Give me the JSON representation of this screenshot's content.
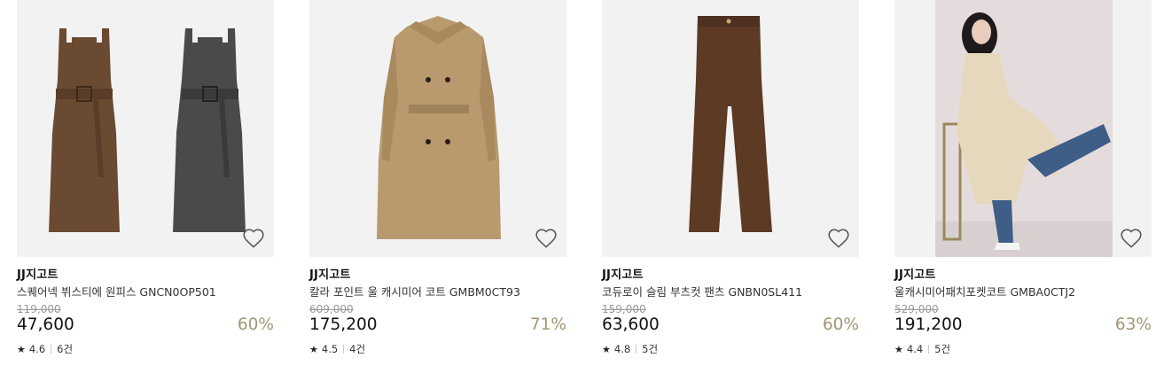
{
  "products": [
    {
      "brand": "JJ지고트",
      "name": "스퀘어넥 뷔스티에 원피스 GNCN0OP501",
      "original_price": "119,000",
      "price": "47,600",
      "discount": "60%",
      "rating": "4.6",
      "reviews": "6건",
      "wishlist_icon": "heart-outline-icon"
    },
    {
      "brand": "JJ지고트",
      "name": "칼라 포인트 울 캐시미어 코트 GMBM0CT93",
      "original_price": "609,000",
      "price": "175,200",
      "discount": "71%",
      "rating": "4.5",
      "reviews": "4건",
      "wishlist_icon": "heart-outline-icon"
    },
    {
      "brand": "JJ지고트",
      "name": "코듀로이 슬림 부츠컷 팬츠 GNBN0SL411",
      "original_price": "159,000",
      "price": "63,600",
      "discount": "60%",
      "rating": "4.8",
      "reviews": "5건",
      "wishlist_icon": "heart-outline-icon"
    },
    {
      "brand": "JJ지고트",
      "name": "울캐시미어패치포켓코트 GMBA0CTJ2",
      "original_price": "529,000",
      "price": "191,200",
      "discount": "63%",
      "rating": "4.4",
      "reviews": "5건",
      "wishlist_icon": "heart-outline-icon"
    }
  ],
  "colors": {
    "discount": "#a09870",
    "background": "#f2f2f2",
    "strike": "#999999"
  }
}
